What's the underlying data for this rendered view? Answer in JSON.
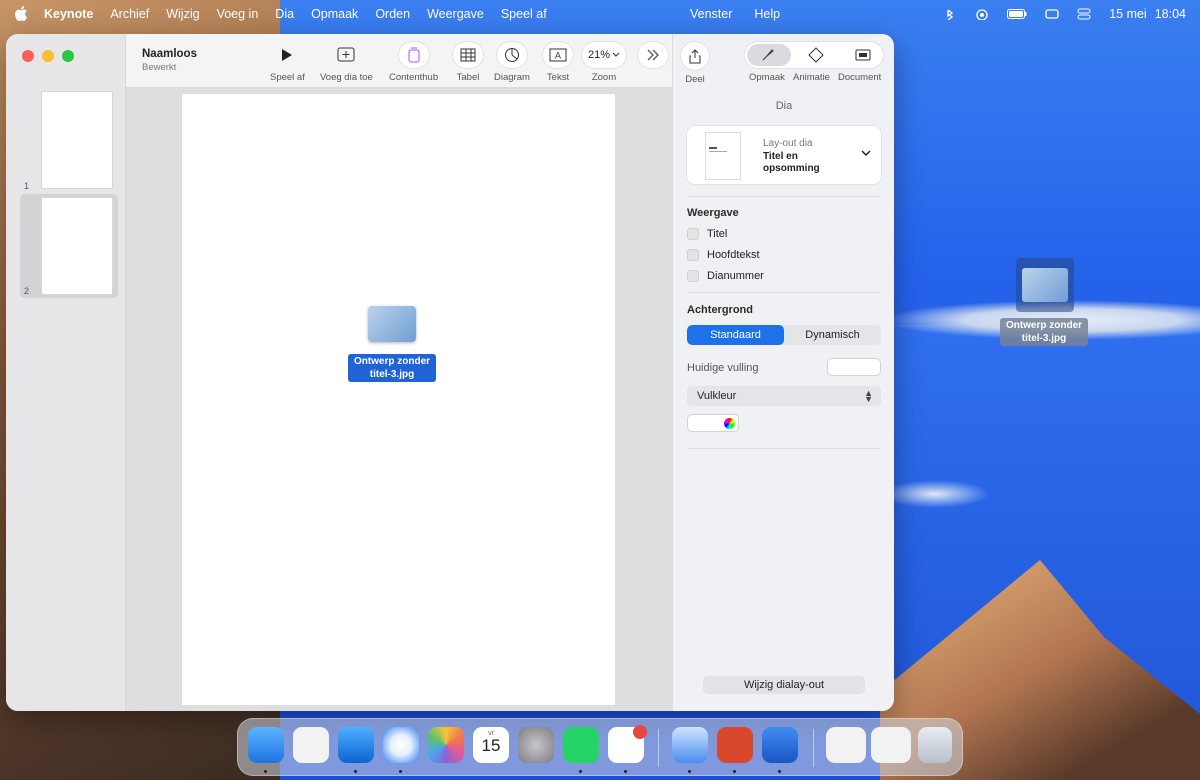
{
  "menubar": {
    "app": "Keynote",
    "items": [
      "Archief",
      "Wijzig",
      "Voeg in",
      "Dia",
      "Opmaak",
      "Orden",
      "Weergave",
      "Speel af"
    ],
    "mid_items": [
      "Venster",
      "Help"
    ],
    "date": "15 mei",
    "time": "18:04"
  },
  "window": {
    "doc_title": "Naamloos",
    "doc_status": "Bewerkt",
    "toolbar": {
      "play": "Speel af",
      "add_slide": "Voeg dia toe",
      "contenthub": "Contenthub",
      "table": "Tabel",
      "chart": "Diagram",
      "text": "Tekst",
      "zoom_value": "21%",
      "zoom": "Zoom",
      "share": "Deel",
      "format": "Opmaak",
      "animate": "Animatie",
      "document": "Document"
    },
    "slides": [
      {
        "num": "1"
      },
      {
        "num": "2"
      }
    ],
    "dragged_file": "Ontwerp zonder titel-3.jpg"
  },
  "inspector": {
    "section": "Dia",
    "layout_small": "Lay-out dia",
    "layout_name": "Titel en opsomming",
    "view_heading": "Weergave",
    "view_options": [
      "Titel",
      "Hoofdtekst",
      "Dianummer"
    ],
    "background_heading": "Achtergrond",
    "seg_standard": "Standaard",
    "seg_dynamic": "Dynamisch",
    "current_fill": "Huidige vulling",
    "fill_type": "Vulkleur",
    "edit_layout": "Wijzig dialay-out"
  },
  "desktop_file": "Ontwerp zonder titel-3.jpg",
  "dock": {
    "calendar_day": "15",
    "calendar_month": "vr"
  }
}
